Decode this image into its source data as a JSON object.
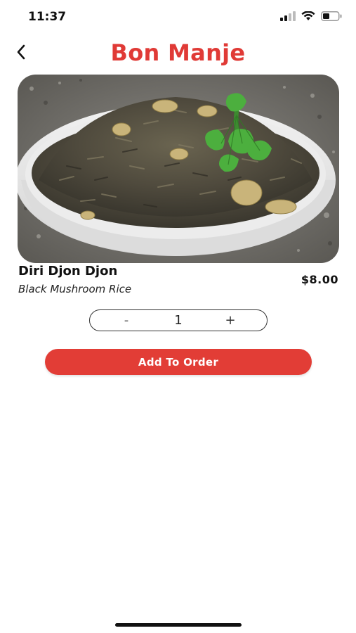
{
  "status_bar": {
    "time": "11:37",
    "signal_icon": "cellular-signal-icon",
    "wifi_icon": "wifi-icon",
    "battery_icon": "battery-icon"
  },
  "header": {
    "title": "Bon Manje",
    "back_icon": "chevron-left-icon",
    "title_color": "#e03a36"
  },
  "item": {
    "image_icon": "food-photo-rice-bowl",
    "name": "Diri Djon Djon",
    "description": "Black Mushroom Rice",
    "price": "$8.00"
  },
  "quantity": {
    "minus_label": "-",
    "value": "1",
    "plus_label": "+"
  },
  "actions": {
    "add_to_order_label": "Add To Order",
    "button_color": "#e23d36"
  }
}
